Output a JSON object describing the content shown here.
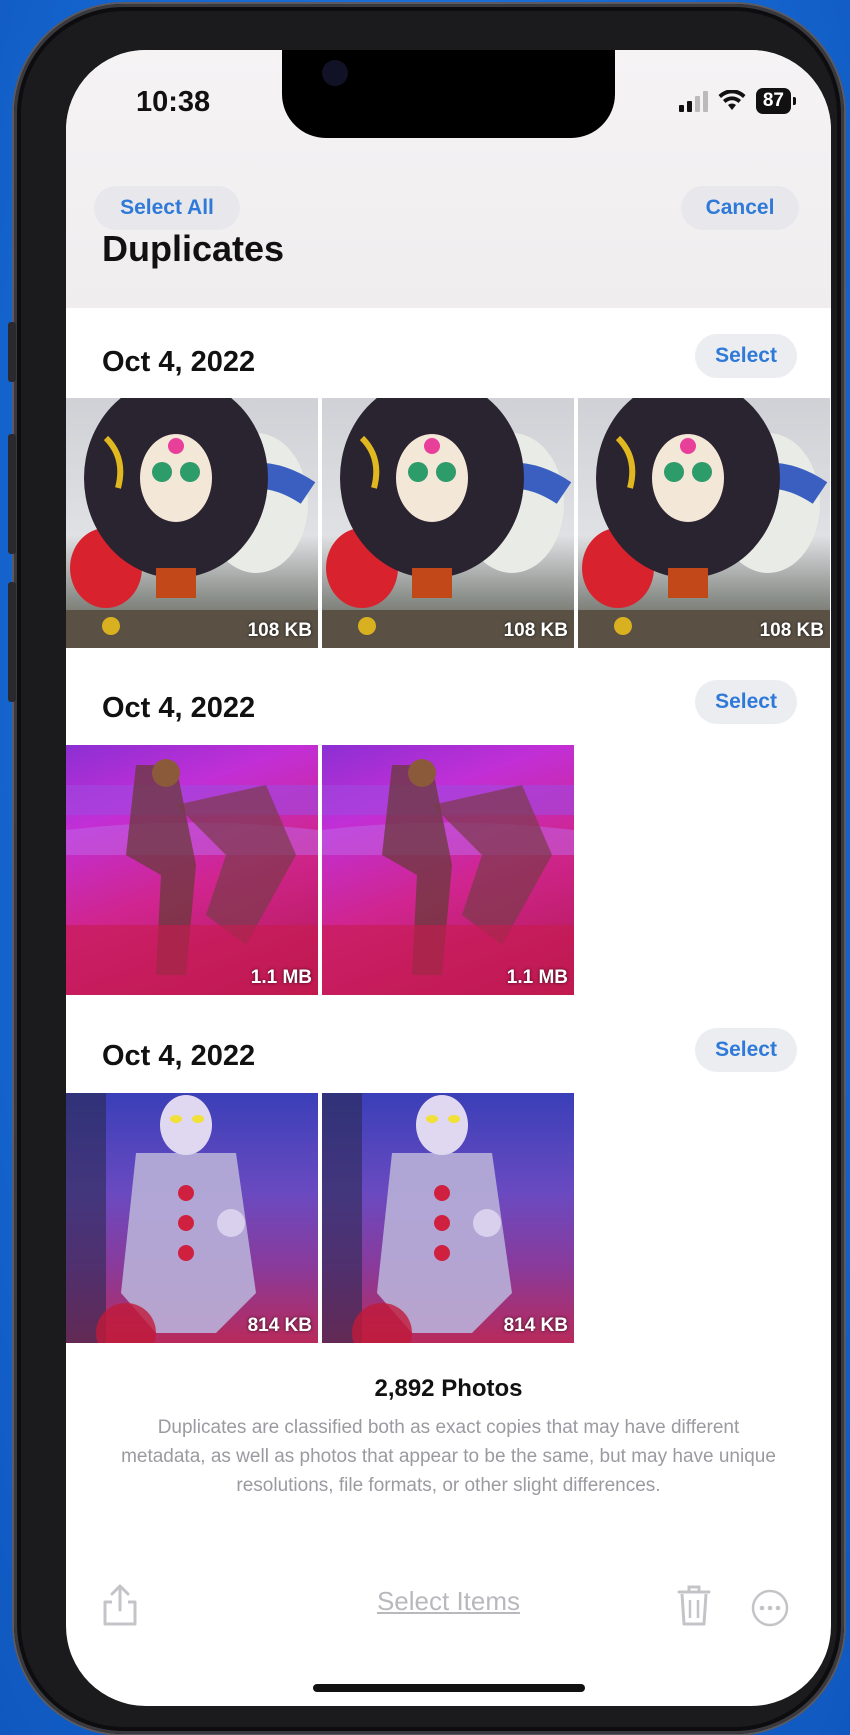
{
  "status_bar": {
    "time": "10:38",
    "battery": "87"
  },
  "nav": {
    "select_all": "Select All",
    "cancel": "Cancel",
    "title": "Duplicates"
  },
  "groups": [
    {
      "date": "Oct 4, 2022",
      "select_label": "Select",
      "items": [
        {
          "size": "108 KB"
        },
        {
          "size": "108 KB"
        },
        {
          "size": "108 KB"
        }
      ]
    },
    {
      "date": "Oct 4, 2022",
      "select_label": "Select",
      "items": [
        {
          "size": "1.1 MB"
        },
        {
          "size": "1.1 MB"
        }
      ]
    },
    {
      "date": "Oct 4, 2022",
      "select_label": "Select",
      "items": [
        {
          "size": "814 KB"
        },
        {
          "size": "814 KB"
        }
      ]
    }
  ],
  "footer": {
    "count": "2,892 Photos",
    "note": "Duplicates are classified both as exact copies that may have different metadata, as well as photos that appear to be the same, but may have unique resolutions, file formats, or other slight differences."
  },
  "toolbar": {
    "select_items": "Select Items"
  },
  "icons": [
    "share-icon",
    "trash-icon",
    "more-icon",
    "wifi-icon",
    "signal-icon",
    "battery-icon"
  ],
  "colors": {
    "accent": "#2f7ad8",
    "background": "#1769d4"
  }
}
